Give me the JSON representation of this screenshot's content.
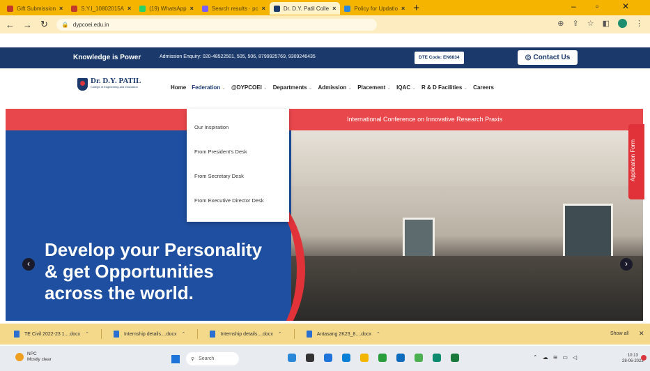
{
  "browser": {
    "tabs": [
      {
        "title": "Gift Submission",
        "active": false
      },
      {
        "title": "S.Y.I_10802015A",
        "active": false
      },
      {
        "title": "(19) WhatsApp",
        "active": false
      },
      {
        "title": "Search results · pc",
        "active": false
      },
      {
        "title": "Dr. D.Y. Patil Colle",
        "active": true
      },
      {
        "title": "Policy for Updatio",
        "active": false
      }
    ],
    "url": "dypcoei.edu.in"
  },
  "site": {
    "motto": "Knowledge is Power",
    "enquiry": "Admission Enquiry: 020-48522501, 505, 506, 8799925769, 9309246435",
    "dte_code": "DTE Code: EN6834",
    "contact_label": "Contact Us",
    "logo": {
      "name": "Dr. D.Y. PATIL",
      "sub": "College of Engineering and Innovation"
    },
    "nav": [
      {
        "label": "Home",
        "caret": false
      },
      {
        "label": "Federation",
        "caret": true
      },
      {
        "label": "@DYPCOEI",
        "caret": true
      },
      {
        "label": "Departments",
        "caret": true
      },
      {
        "label": "Admission",
        "caret": true
      },
      {
        "label": "Placement",
        "caret": true
      },
      {
        "label": "IQAC",
        "caret": true
      },
      {
        "label": "R & D Facilities",
        "caret": true
      },
      {
        "label": "Careers",
        "caret": false
      }
    ],
    "conference": "International Conference on Innovative Research Praxis",
    "dropdown": [
      "Our Inspiration",
      "From President's Desk",
      "From Secretary Desk",
      "From Executive Director Desk"
    ],
    "hero": [
      "Develop your Personality",
      "& get Opportunities",
      "across the world."
    ],
    "application_form": "Application Form"
  },
  "downloads": {
    "items": [
      "TE Civil 2022-23 1....docx",
      "Internship details....docx",
      "Internship details....docx",
      "Antasang 2K23_8....docx"
    ],
    "show_all": "Show all"
  },
  "taskbar": {
    "weather_temp": "NPC",
    "weather_desc": "Mostly clear",
    "search": "Search",
    "time": "10:13",
    "date": "28-06-2023",
    "app_colors": [
      "#2b88d8",
      "#333333",
      "#1e74d8",
      "#0a7fd6",
      "#f2b600",
      "#2a9d3c",
      "#0f6cbd",
      "#4caf50",
      "#0e8a6f",
      "#1a7a3c"
    ]
  }
}
